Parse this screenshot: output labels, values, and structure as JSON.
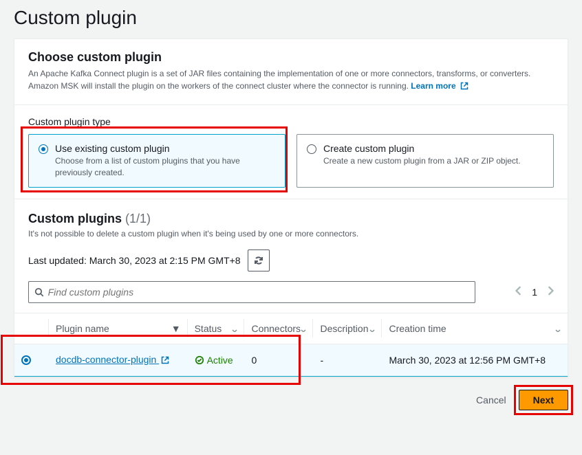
{
  "page": {
    "title": "Custom plugin"
  },
  "choose": {
    "heading": "Choose custom plugin",
    "description": "An Apache Kafka Connect plugin is a set of JAR files containing the implementation of one or more connectors, transforms, or converters. Amazon MSK will install the plugin on the workers of the connect cluster where the connector is running.",
    "learn_more": "Learn more"
  },
  "type": {
    "label": "Custom plugin type",
    "existing": {
      "title": "Use existing custom plugin",
      "desc": "Choose from a list of custom plugins that you have previously created."
    },
    "create": {
      "title": "Create custom plugin",
      "desc": "Create a new custom plugin from a JAR or ZIP object."
    }
  },
  "plugins": {
    "heading": "Custom plugins",
    "count": "(1/1)",
    "note": "It's not possible to delete a custom plugin when it's being used by one or more connectors.",
    "last_updated_label": "Last updated:",
    "last_updated_value": "March 30, 2023 at 2:15 PM GMT+8",
    "search_placeholder": "Find custom plugins",
    "page": "1",
    "columns": {
      "name": "Plugin name",
      "status": "Status",
      "connectors": "Connectors",
      "description": "Description",
      "creation": "Creation time"
    },
    "rows": [
      {
        "name": "docdb-connector-plugin",
        "status": "Active",
        "connectors": "0",
        "description": "-",
        "creation": "March 30, 2023 at 12:56 PM GMT+8"
      }
    ]
  },
  "footer": {
    "cancel": "Cancel",
    "next": "Next"
  }
}
